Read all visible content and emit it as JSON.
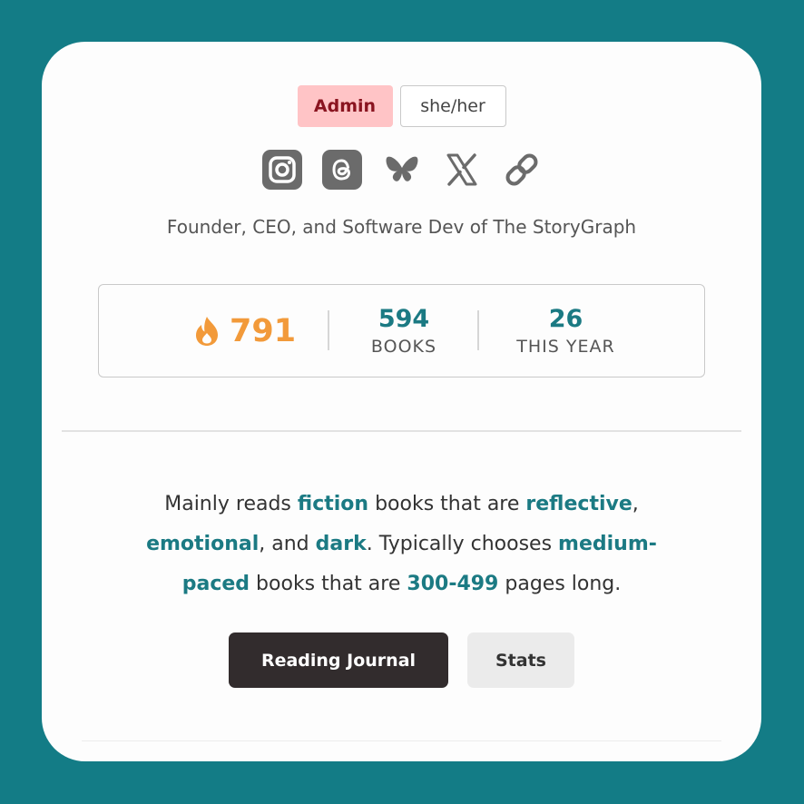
{
  "profile": {
    "badges": {
      "role": "Admin",
      "pronouns": "she/her"
    },
    "socials": [
      "instagram-icon",
      "threads-icon",
      "bluesky-icon",
      "x-icon",
      "link-icon"
    ],
    "bio": "Founder, CEO, and Software Dev of The StoryGraph"
  },
  "stats": {
    "streak": "791",
    "books_count": "594",
    "books_label": "BOOKS",
    "year_count": "26",
    "year_label": "THIS YEAR"
  },
  "summary": {
    "p1": "Mainly reads ",
    "h1": "fiction",
    "p2": " books that are ",
    "h2": "reflective",
    "p3": ",",
    "h3": "emotional",
    "p4": ", and ",
    "h4": "dark",
    "p5": ". Typically chooses ",
    "h5": "medium-",
    "h6": "paced",
    "p6": " books that are ",
    "h7": "300-499",
    "p7": " pages long."
  },
  "actions": {
    "journal": "Reading Journal",
    "stats": "Stats"
  },
  "colors": {
    "background": "#137c86",
    "accent": "#1b7a83",
    "streak": "#f29a3a",
    "admin_badge_bg": "#ffc4c6",
    "admin_badge_text": "#8a1420",
    "primary_button": "#322c2d"
  }
}
